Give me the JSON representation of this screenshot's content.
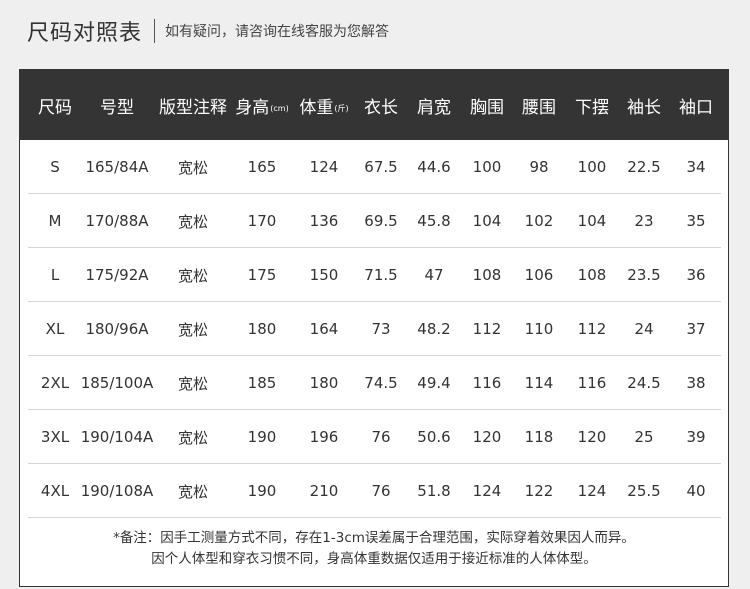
{
  "header": {
    "title": "尺码对照表",
    "subtitle": "如有疑问，请咨询在线客服为您解答"
  },
  "table": {
    "columns": [
      {
        "label": "尺码",
        "unit": ""
      },
      {
        "label": "号型",
        "unit": ""
      },
      {
        "label": "版型注释",
        "unit": ""
      },
      {
        "label": "身高",
        "unit": "(cm)"
      },
      {
        "label": "体重",
        "unit": "(斤)"
      },
      {
        "label": "衣长",
        "unit": ""
      },
      {
        "label": "肩宽",
        "unit": ""
      },
      {
        "label": "胸围",
        "unit": ""
      },
      {
        "label": "腰围",
        "unit": ""
      },
      {
        "label": "下摆",
        "unit": ""
      },
      {
        "label": "袖长",
        "unit": ""
      },
      {
        "label": "袖口",
        "unit": ""
      }
    ],
    "rows": [
      [
        "S",
        "165/84A",
        "宽松",
        "165",
        "124",
        "67.5",
        "44.6",
        "100",
        "98",
        "100",
        "22.5",
        "34"
      ],
      [
        "M",
        "170/88A",
        "宽松",
        "170",
        "136",
        "69.5",
        "45.8",
        "104",
        "102",
        "104",
        "23",
        "35"
      ],
      [
        "L",
        "175/92A",
        "宽松",
        "175",
        "150",
        "71.5",
        "47",
        "108",
        "106",
        "108",
        "23.5",
        "36"
      ],
      [
        "XL",
        "180/96A",
        "宽松",
        "180",
        "164",
        "73",
        "48.2",
        "112",
        "110",
        "112",
        "24",
        "37"
      ],
      [
        "2XL",
        "185/100A",
        "宽松",
        "185",
        "180",
        "74.5",
        "49.4",
        "116",
        "114",
        "116",
        "24.5",
        "38"
      ],
      [
        "3XL",
        "190/104A",
        "宽松",
        "190",
        "196",
        "76",
        "50.6",
        "120",
        "118",
        "120",
        "25",
        "39"
      ],
      [
        "4XL",
        "190/108A",
        "宽松",
        "190",
        "210",
        "76",
        "51.8",
        "124",
        "122",
        "124",
        "25.5",
        "40"
      ]
    ]
  },
  "notes": {
    "line1": "*备注：因手工测量方式不同，存在1-3cm误差属于合理范围，实际穿着效果因人而异。",
    "line2": "因个人体型和穿衣习惯不同，身高体重数据仅适用于接近标准的人体体型。"
  },
  "colors": {
    "header_bg": "#343434",
    "header_text": "#ffffff",
    "row_divider": "#d6d6d6",
    "page_bg": "#efefef"
  }
}
